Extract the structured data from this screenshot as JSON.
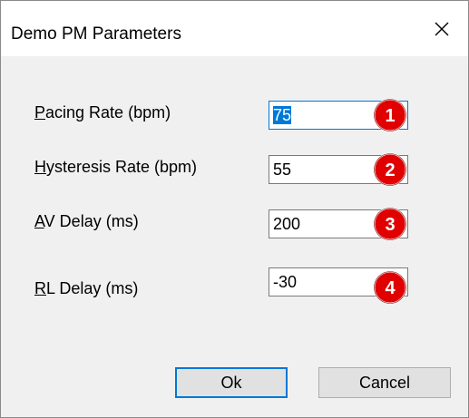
{
  "window": {
    "title": "Demo PM Parameters",
    "close_symbol": "✕"
  },
  "fields": [
    {
      "label_underlined": "P",
      "label_rest": "acing Rate (bpm)",
      "value": "75",
      "badge": "1"
    },
    {
      "label_underlined": "H",
      "label_rest": "ysteresis Rate (bpm)",
      "value": "55",
      "badge": "2"
    },
    {
      "label_underlined": "A",
      "label_rest": "V Delay (ms)",
      "value": "200",
      "badge": "3"
    },
    {
      "label_underlined": "R",
      "label_rest": "L Delay (ms)",
      "value": "-30",
      "badge": "4"
    }
  ],
  "buttons": {
    "ok_label": "Ok",
    "cancel_label": "Cancel"
  },
  "colors": {
    "badge_fill": "#e00000",
    "focus_accent": "#0078d7"
  }
}
